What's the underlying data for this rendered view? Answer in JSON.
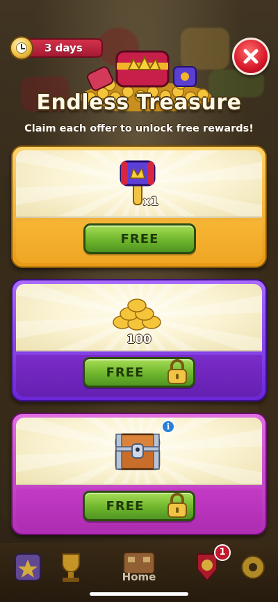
{
  "timer": {
    "label": "3 days",
    "icon": "clock-icon"
  },
  "close": {
    "icon": "close-icon"
  },
  "header": {
    "title": "Endless Treasure",
    "subtitle": "Claim each offer to unlock free rewards!"
  },
  "offers": [
    {
      "reward": "hammer",
      "count": "x1",
      "button": "FREE",
      "locked": false,
      "color": "#f0a928"
    },
    {
      "reward": "coins",
      "count": "100",
      "button": "FREE",
      "locked": true,
      "color": "#6a24b8"
    },
    {
      "reward": "chest",
      "count": "",
      "button": "FREE",
      "locked": true,
      "color": "#b02eb5"
    }
  ],
  "info": {
    "label": "i"
  },
  "nav": {
    "home_label": "Home",
    "badge_count": "1"
  }
}
